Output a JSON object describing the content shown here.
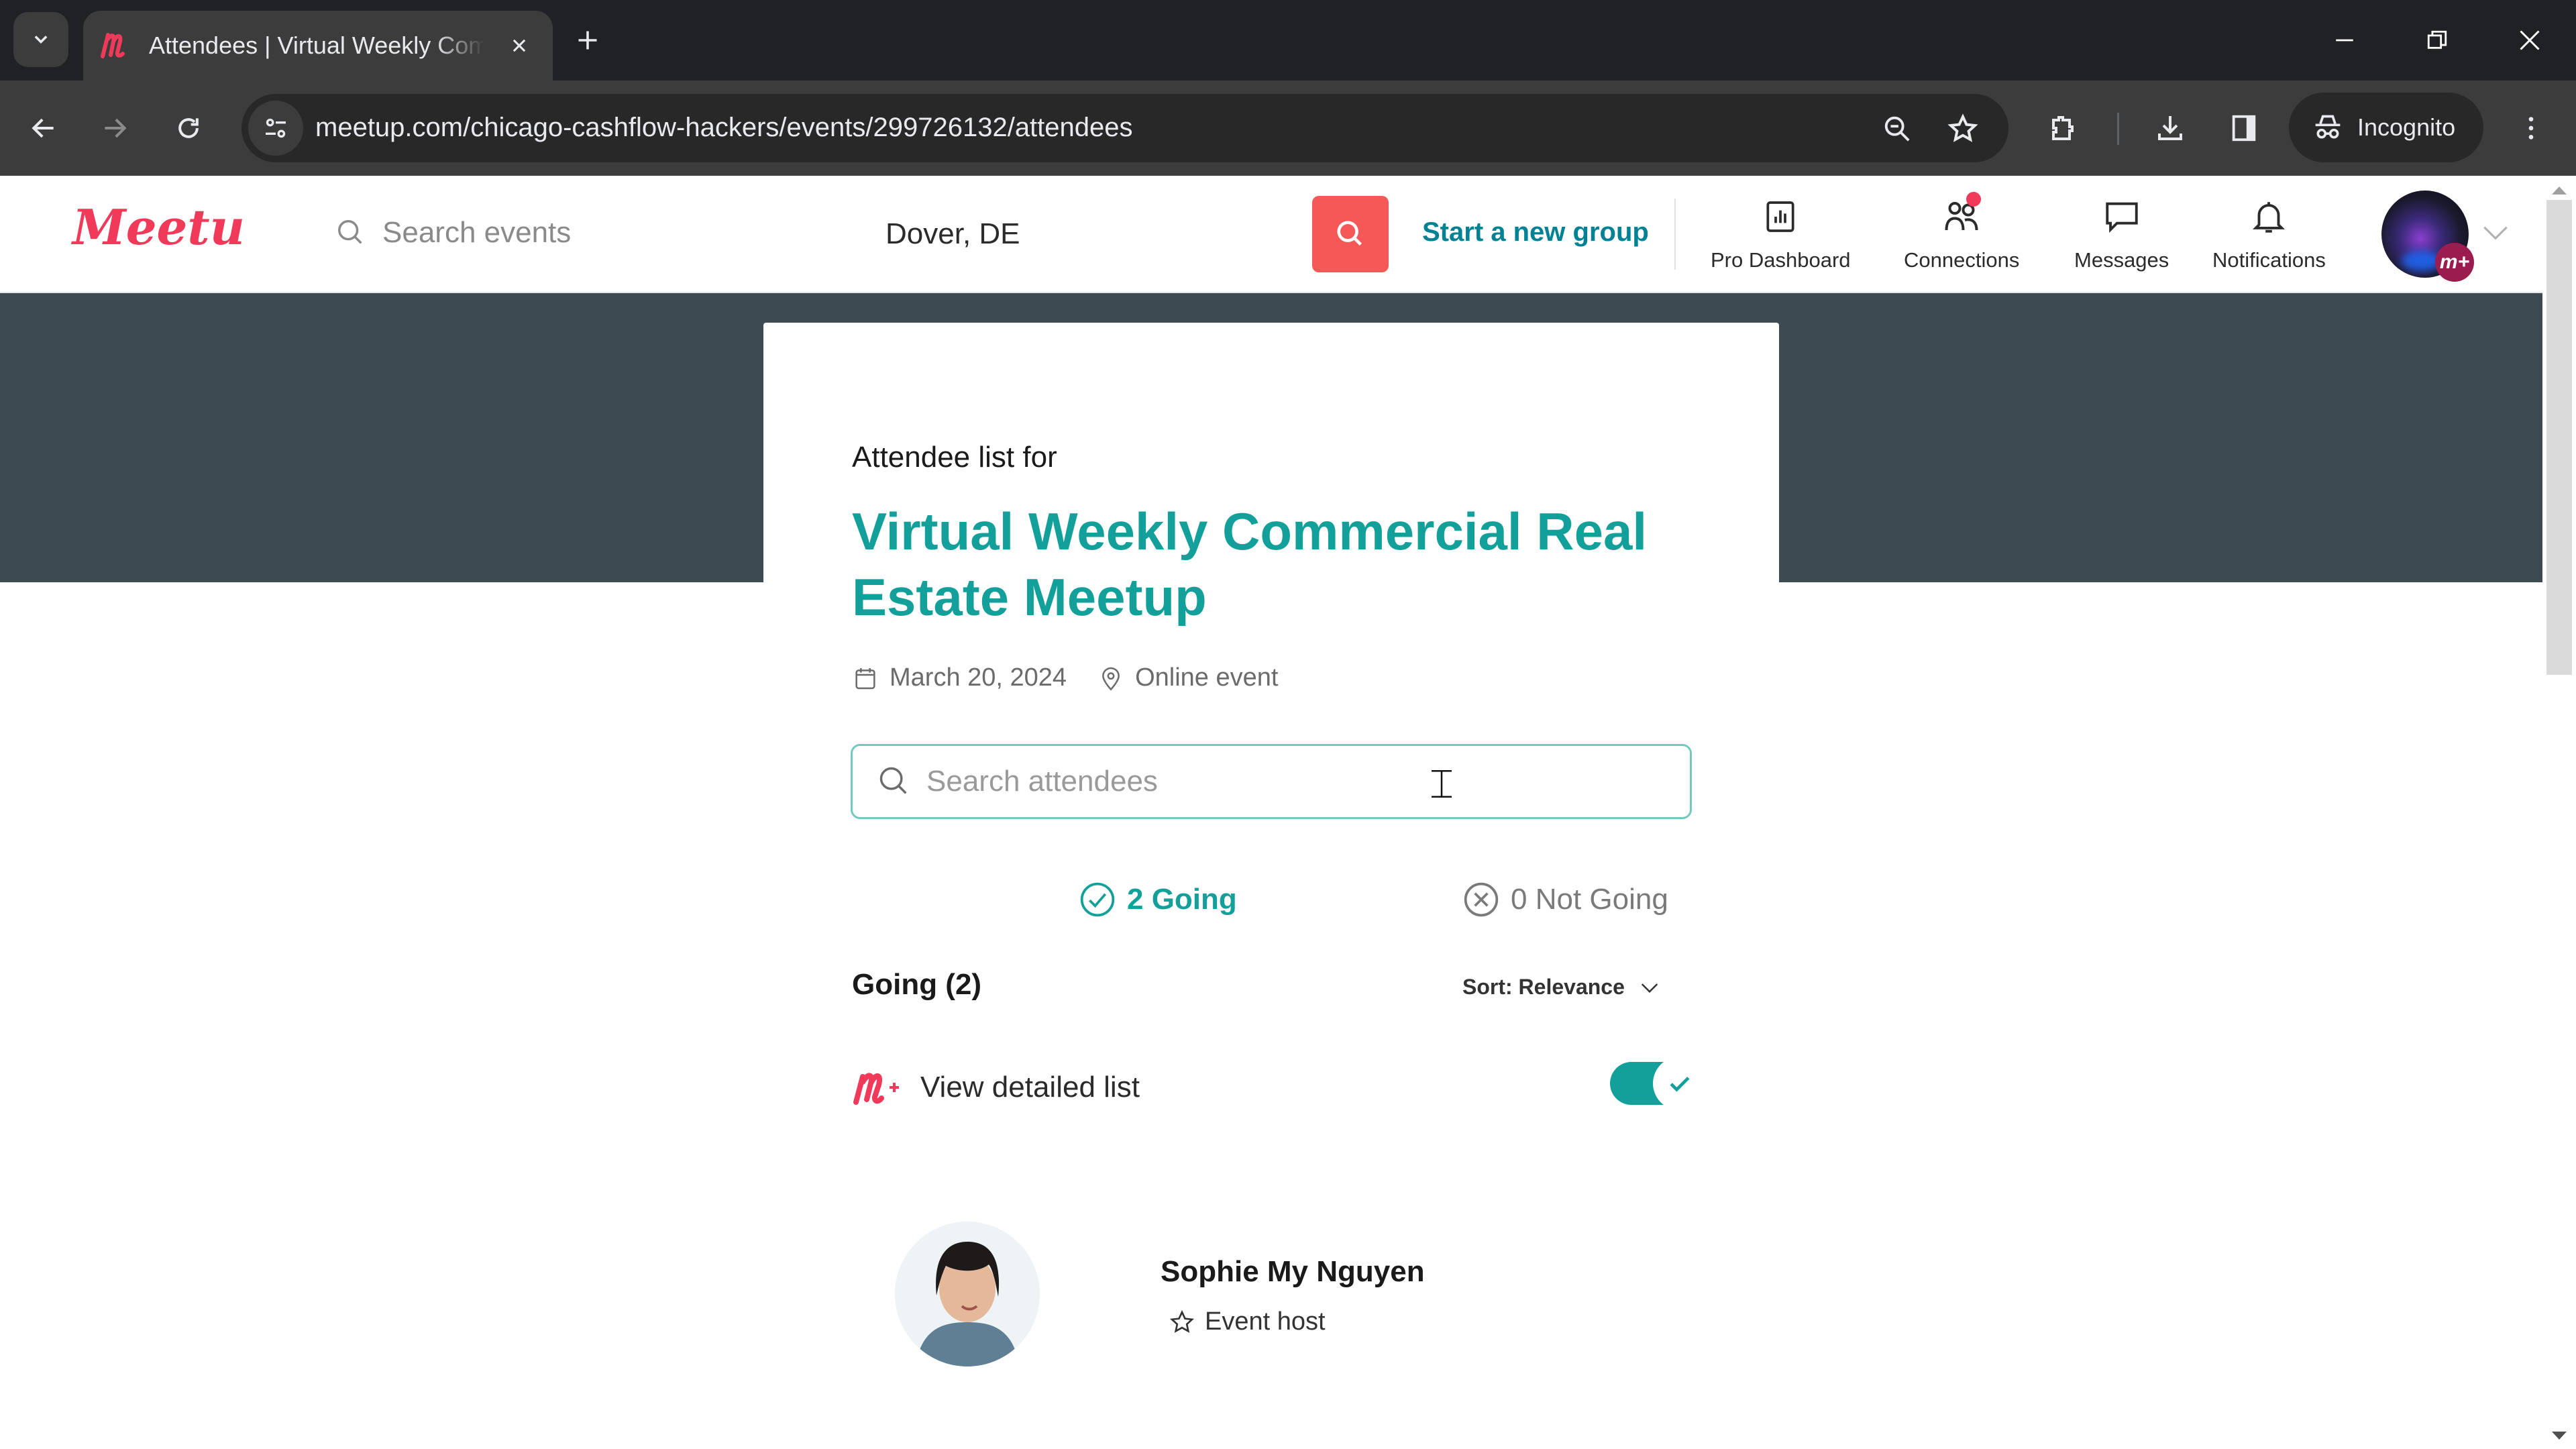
{
  "browser": {
    "tab_title": "Attendees | Virtual Weekly Commercial Real Estate Meetup",
    "url": "meetup.com/chicago-cashflow-hackers/events/299726132/attendees",
    "profile_label": "Incognito",
    "icons": {
      "tab_list": "chevron-down-icon",
      "favicon": "meetup-favicon",
      "tab_close": "close-icon",
      "new_tab": "plus-icon",
      "back": "arrow-left-icon",
      "forward": "arrow-right-icon",
      "reload": "reload-icon",
      "site_info": "tune-icon",
      "zoom": "zoom-out-icon",
      "bookmark": "star-icon",
      "extensions": "puzzle-icon",
      "downloads": "download-icon",
      "side_panel": "side-panel-icon",
      "incognito": "incognito-icon",
      "menu": "kebab-menu-icon",
      "minimize": "minimize-icon",
      "restore": "restore-icon",
      "close_window": "close-icon"
    }
  },
  "site_header": {
    "logo_text": "Meetup",
    "search_placeholder": "Search events",
    "location": "Dover, DE",
    "start_group_label": "Start a new group",
    "nav": [
      {
        "label": "Pro Dashboard",
        "icon": "bar-chart-icon"
      },
      {
        "label": "Connections",
        "icon": "people-icon",
        "has_notification_dot": true
      },
      {
        "label": "Messages",
        "icon": "chat-bubble-icon"
      },
      {
        "label": "Notifications",
        "icon": "bell-icon"
      }
    ],
    "plus_badge": "m+"
  },
  "event": {
    "kicker": "Attendee list for",
    "title": "Virtual Weekly Commercial Real Estate Meetup",
    "date": "March 20, 2024",
    "location": "Online event"
  },
  "attendees": {
    "search_placeholder": "Search attendees",
    "search_value": "",
    "tabs": [
      {
        "label": "2 Going",
        "count": 2,
        "active": true
      },
      {
        "label": "0 Not Going",
        "count": 0,
        "active": false
      }
    ],
    "section_heading": "Going (2)",
    "sort_label": "Sort: Relevance",
    "detailed_list_label": "View detailed list",
    "detailed_list_enabled": true,
    "list": [
      {
        "name": "Sophie My Nguyen",
        "role": "Event host"
      }
    ]
  },
  "colors": {
    "brand_pink": "#f13a59",
    "teal_accent": "#14a09a",
    "hero_band": "#3d4a52",
    "search_button": "#f65858"
  }
}
